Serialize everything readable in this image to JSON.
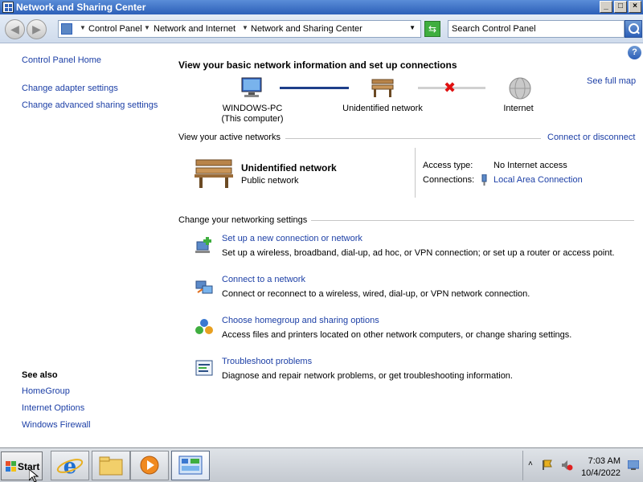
{
  "window": {
    "title": "Network and Sharing Center",
    "buttons": {
      "minimize": "_",
      "maximize": "□",
      "close": "×"
    }
  },
  "address": {
    "breadcrumb": [
      "Control Panel",
      "Network and Internet",
      "Network and Sharing Center"
    ],
    "search_placeholder": "Search Control Panel"
  },
  "sidebar": {
    "home": "Control Panel Home",
    "links": [
      "Change adapter settings",
      "Change advanced sharing settings"
    ],
    "see_also_title": "See also",
    "see_also": [
      "HomeGroup",
      "Internet Options",
      "Windows Firewall"
    ]
  },
  "main": {
    "heading": "View your basic network information and set up connections",
    "see_full_map": "See full map",
    "map": {
      "computer_name": "WINDOWS-PC",
      "computer_sub": "(This computer)",
      "network": "Unidentified network",
      "internet": "Internet"
    },
    "active_label": "View your active networks",
    "connect_link": "Connect or disconnect",
    "active_network": {
      "name": "Unidentified network",
      "type": "Public network",
      "access_label": "Access type:",
      "access_value": "No Internet access",
      "connections_label": "Connections:",
      "connections_value": "Local Area Connection"
    },
    "change_label": "Change your networking settings",
    "tasks": [
      {
        "title": "Set up a new connection or network",
        "desc": "Set up a wireless, broadband, dial-up, ad hoc, or VPN connection; or set up a router or access point.",
        "icon": "new-connection-icon"
      },
      {
        "title": "Connect to a network",
        "desc": "Connect or reconnect to a wireless, wired, dial-up, or VPN network connection.",
        "icon": "connect-network-icon"
      },
      {
        "title": "Choose homegroup and sharing options",
        "desc": "Access files and printers located on other network computers, or change sharing settings.",
        "icon": "homegroup-icon"
      },
      {
        "title": "Troubleshoot problems",
        "desc": "Diagnose and repair network problems, or get troubleshooting information.",
        "icon": "troubleshoot-icon"
      }
    ]
  },
  "taskbar": {
    "start": "Start",
    "time": "7:03 AM",
    "date": "10/4/2022"
  },
  "colors": {
    "link": "#1c3fa6",
    "title_bar": "#2c5fb8"
  }
}
